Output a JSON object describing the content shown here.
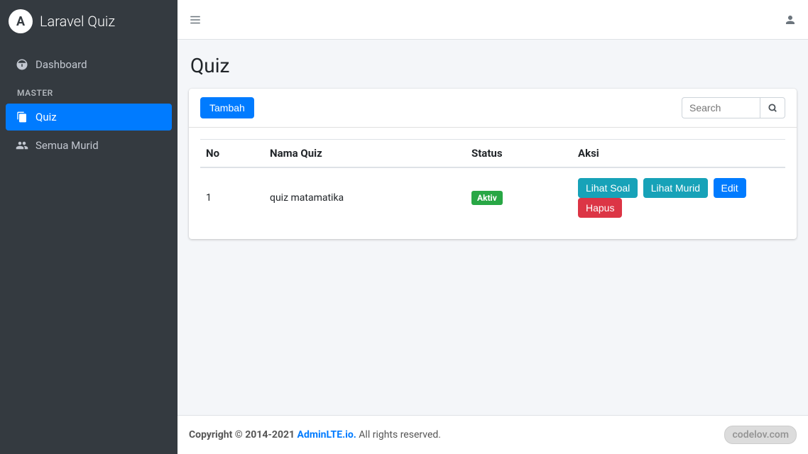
{
  "brand": {
    "logo_letter": "A",
    "title": "Laravel Quiz"
  },
  "sidebar": {
    "items": [
      {
        "label": "Dashboard",
        "active": false
      },
      {
        "label": "Quiz",
        "active": true
      },
      {
        "label": "Semua Murid",
        "active": false
      }
    ],
    "section_header": "MASTER"
  },
  "page": {
    "title": "Quiz"
  },
  "toolbar": {
    "add_label": "Tambah",
    "search_placeholder": "Search"
  },
  "table": {
    "headers": {
      "no": "No",
      "name": "Nama Quiz",
      "status": "Status",
      "action": "Aksi"
    },
    "rows": [
      {
        "no": "1",
        "name": "quiz matamatika",
        "status": "Aktiv",
        "actions": {
          "view_q": "Lihat Soal",
          "view_s": "Lihat Murid",
          "edit": "Edit",
          "delete": "Hapus"
        }
      }
    ]
  },
  "footer": {
    "copyright_prefix": "Copyright © 2014-2021 ",
    "link_text": "AdminLTE.io.",
    "suffix": " All rights reserved.",
    "watermark": "codelov.com"
  }
}
